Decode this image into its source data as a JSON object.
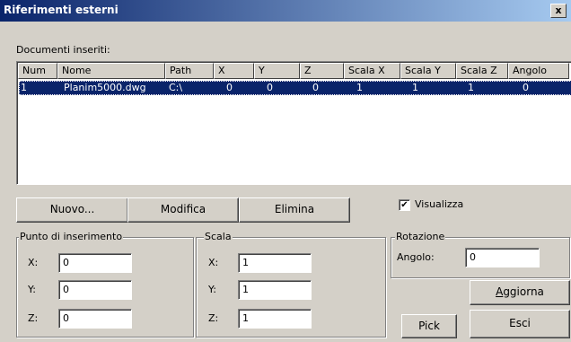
{
  "window": {
    "title": "Riferimenti esterni",
    "close_label": "x"
  },
  "list": {
    "label": "Documenti inseriti:",
    "columns": [
      "Num",
      "Nome",
      "Path",
      "X",
      "Y",
      "Z",
      "Scala X",
      "Scala Y",
      "Scala Z",
      "Angolo"
    ],
    "rows": [
      [
        "1",
        "Planim5000.dwg",
        "C:\\",
        "0",
        "0",
        "0",
        "1",
        "1",
        "1",
        "0"
      ]
    ]
  },
  "buttons": {
    "nuovo": "Nuovo...",
    "modifica": "Modifica",
    "elimina": "Elimina",
    "aggiorna_pre": "A",
    "aggiorna_post": "ggiorna",
    "pick": "Pick",
    "esci": "Esci"
  },
  "visualizza": {
    "label": "Visualizza",
    "checked": true,
    "mark": "✔"
  },
  "punto": {
    "title": "Punto di inserimento",
    "x_label": "X:",
    "x": "0",
    "y_label": "Y:",
    "y": "0",
    "z_label": "Z:",
    "z": "0"
  },
  "scala": {
    "title": "Scala",
    "x_label": "X:",
    "x": "1",
    "y_label": "Y:",
    "y": "1",
    "z_label": "Z:",
    "z": "1"
  },
  "rotazione": {
    "title": "Rotazione",
    "angolo_label": "Angolo:",
    "angolo": "0"
  }
}
